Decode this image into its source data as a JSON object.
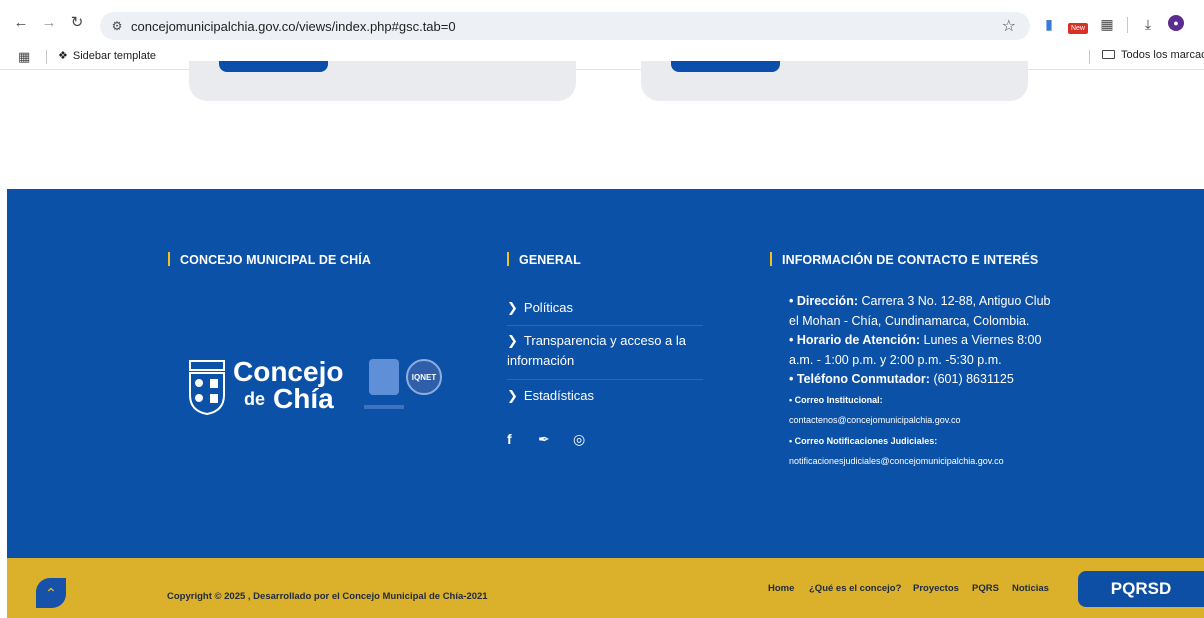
{
  "browser": {
    "url": "concejomunicipalchia.gov.co/views/index.php#gsc.tab=0",
    "bookmark_item": "Sidebar template",
    "bookmark_folder": "Todos los marcador",
    "new_badge": "New"
  },
  "footer": {
    "col1_title": "CONCEJO MUNICIPAL DE CHÍA",
    "logo_line1": "Concejo",
    "logo_de": "de",
    "logo_chia": "Chía",
    "cert_label": "IQNET",
    "col2_title": "GENERAL",
    "links": [
      "Políticas",
      "Transparencia y acceso a la información",
      "Estadísticas"
    ],
    "col3_title": "INFORMACIÓN DE CONTACTO E INTERÉS",
    "contact": {
      "dir_label": "Dirección:",
      "dir_value": "Carrera 3 No. 12-88, Antiguo Club el Mohan - Chía, Cundinamarca, Colombia.",
      "hours_label": "Horario de Atención:",
      "hours_value": "Lunes a Viernes 8:00 a.m. - 1:00 p.m. y 2:00 p.m. -5:30 p.m.",
      "phone_label": "Teléfono Conmutador:",
      "phone_value": "(601) 8631125",
      "mail_label": "Correo Institucional:",
      "mail_value": "contactenos@concejomunicipalchia.gov.co",
      "legal_label": "Correo Notificaciones Judiciales:",
      "legal_value": "notificacionesjudiciales@concejomunicipalchia.gov.co"
    }
  },
  "bottom": {
    "copyright": "Copyright © 2025 , Desarrollado por el Concejo Municipal de Chía-2021",
    "menu": [
      "Home",
      "¿Qué es el concejo?",
      "Proyectos",
      "PQRS",
      "Noticias"
    ],
    "pqrsd": "PQRSD"
  },
  "colors": {
    "footer_blue": "#0c51a8",
    "accent_yellow": "#dbb02a",
    "button_blue": "#0e4fa6"
  }
}
